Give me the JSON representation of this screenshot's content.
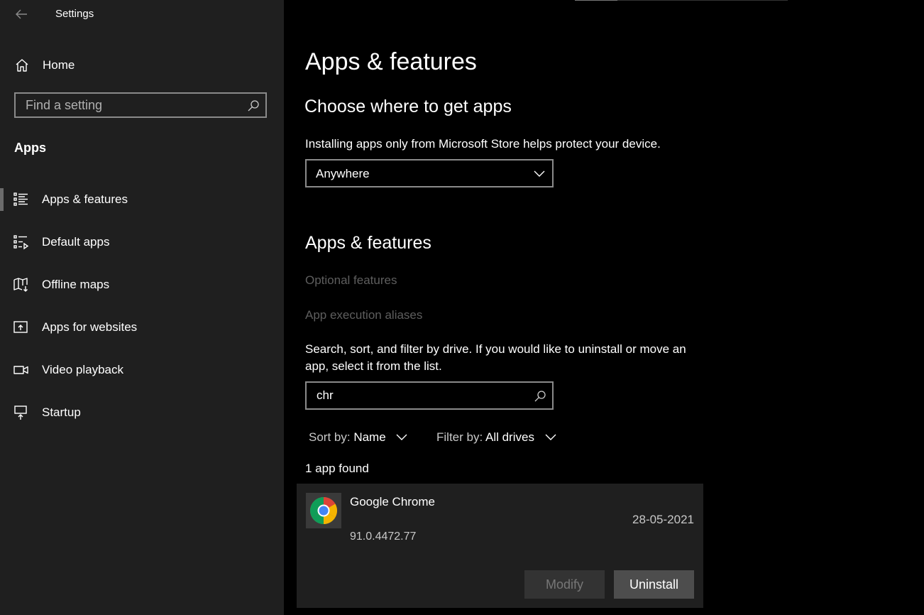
{
  "window": {
    "title": "Settings"
  },
  "sidebar": {
    "home_label": "Home",
    "search_placeholder": "Find a setting",
    "section_label": "Apps",
    "items": [
      {
        "label": "Apps & features",
        "icon": "apps-features-icon",
        "selected": true
      },
      {
        "label": "Default apps",
        "icon": "default-apps-icon",
        "selected": false
      },
      {
        "label": "Offline maps",
        "icon": "offline-maps-icon",
        "selected": false
      },
      {
        "label": "Apps for websites",
        "icon": "apps-websites-icon",
        "selected": false
      },
      {
        "label": "Video playback",
        "icon": "video-playback-icon",
        "selected": false
      },
      {
        "label": "Startup",
        "icon": "startup-icon",
        "selected": false
      }
    ]
  },
  "main": {
    "page_title": "Apps & features",
    "choose_heading": "Choose where to get apps",
    "choose_desc": "Installing apps only from Microsoft Store helps protect your device.",
    "source_dropdown": {
      "selected": "Anywhere"
    },
    "features_heading": "Apps & features",
    "optional_features_link": "Optional features",
    "aliases_link": "App execution aliases",
    "filter_desc": "Search, sort, and filter by drive. If you would like to uninstall or move an app, select it from the list.",
    "app_search": {
      "value": "chr"
    },
    "sort": {
      "label": "Sort by:",
      "value": "Name"
    },
    "filter": {
      "label": "Filter by:",
      "value": "All drives"
    },
    "results_count": "1 app found",
    "app": {
      "name": "Google Chrome",
      "version": "91.0.4472.77",
      "date": "28-05-2021",
      "modify_label": "Modify",
      "uninstall_label": "Uninstall"
    }
  },
  "colors": {
    "sidebar_bg": "#1f1f1f",
    "main_bg": "#000000",
    "disabled_text": "#5e5e5e",
    "border": "#8a8a8a"
  }
}
